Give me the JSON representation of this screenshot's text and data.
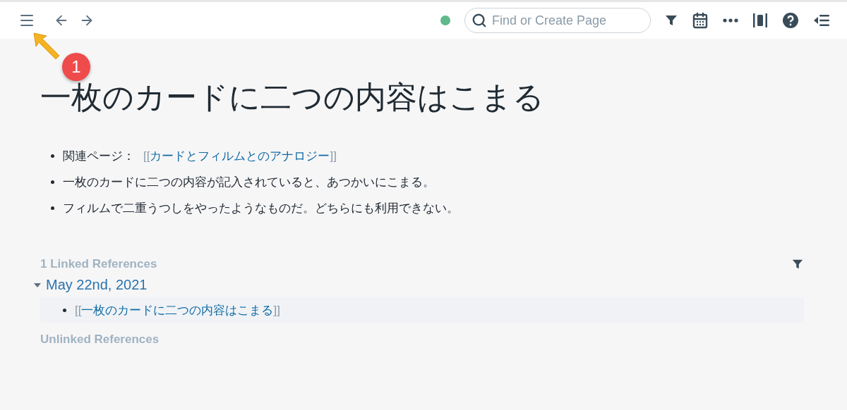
{
  "toolbar": {
    "search": {
      "placeholder": "Find or Create Page"
    }
  },
  "annotation": {
    "step": "1"
  },
  "page": {
    "title": "一枚のカードに二つの内容はこまる",
    "blocks": [
      {
        "text": "関連ページ：",
        "link": {
          "open": "[[",
          "label": "カードとフィルムとのアナロジー",
          "close": "]]"
        }
      },
      {
        "text": "一枚のカードに二つの内容が記入されていると、あつかいにこまる。"
      },
      {
        "text": "フィルムで二重うつしをやったようなものだ。どちらにも利用できない。"
      }
    ]
  },
  "linked_references": {
    "heading": "1 Linked References",
    "groups": [
      {
        "date": "May 22nd, 2021",
        "expanded": true,
        "refs": [
          {
            "open": "[[",
            "label": "一枚のカードに二つの内容はこまる",
            "close": "]]"
          }
        ]
      }
    ]
  },
  "unlinked_references": {
    "heading": "Unlinked References"
  }
}
